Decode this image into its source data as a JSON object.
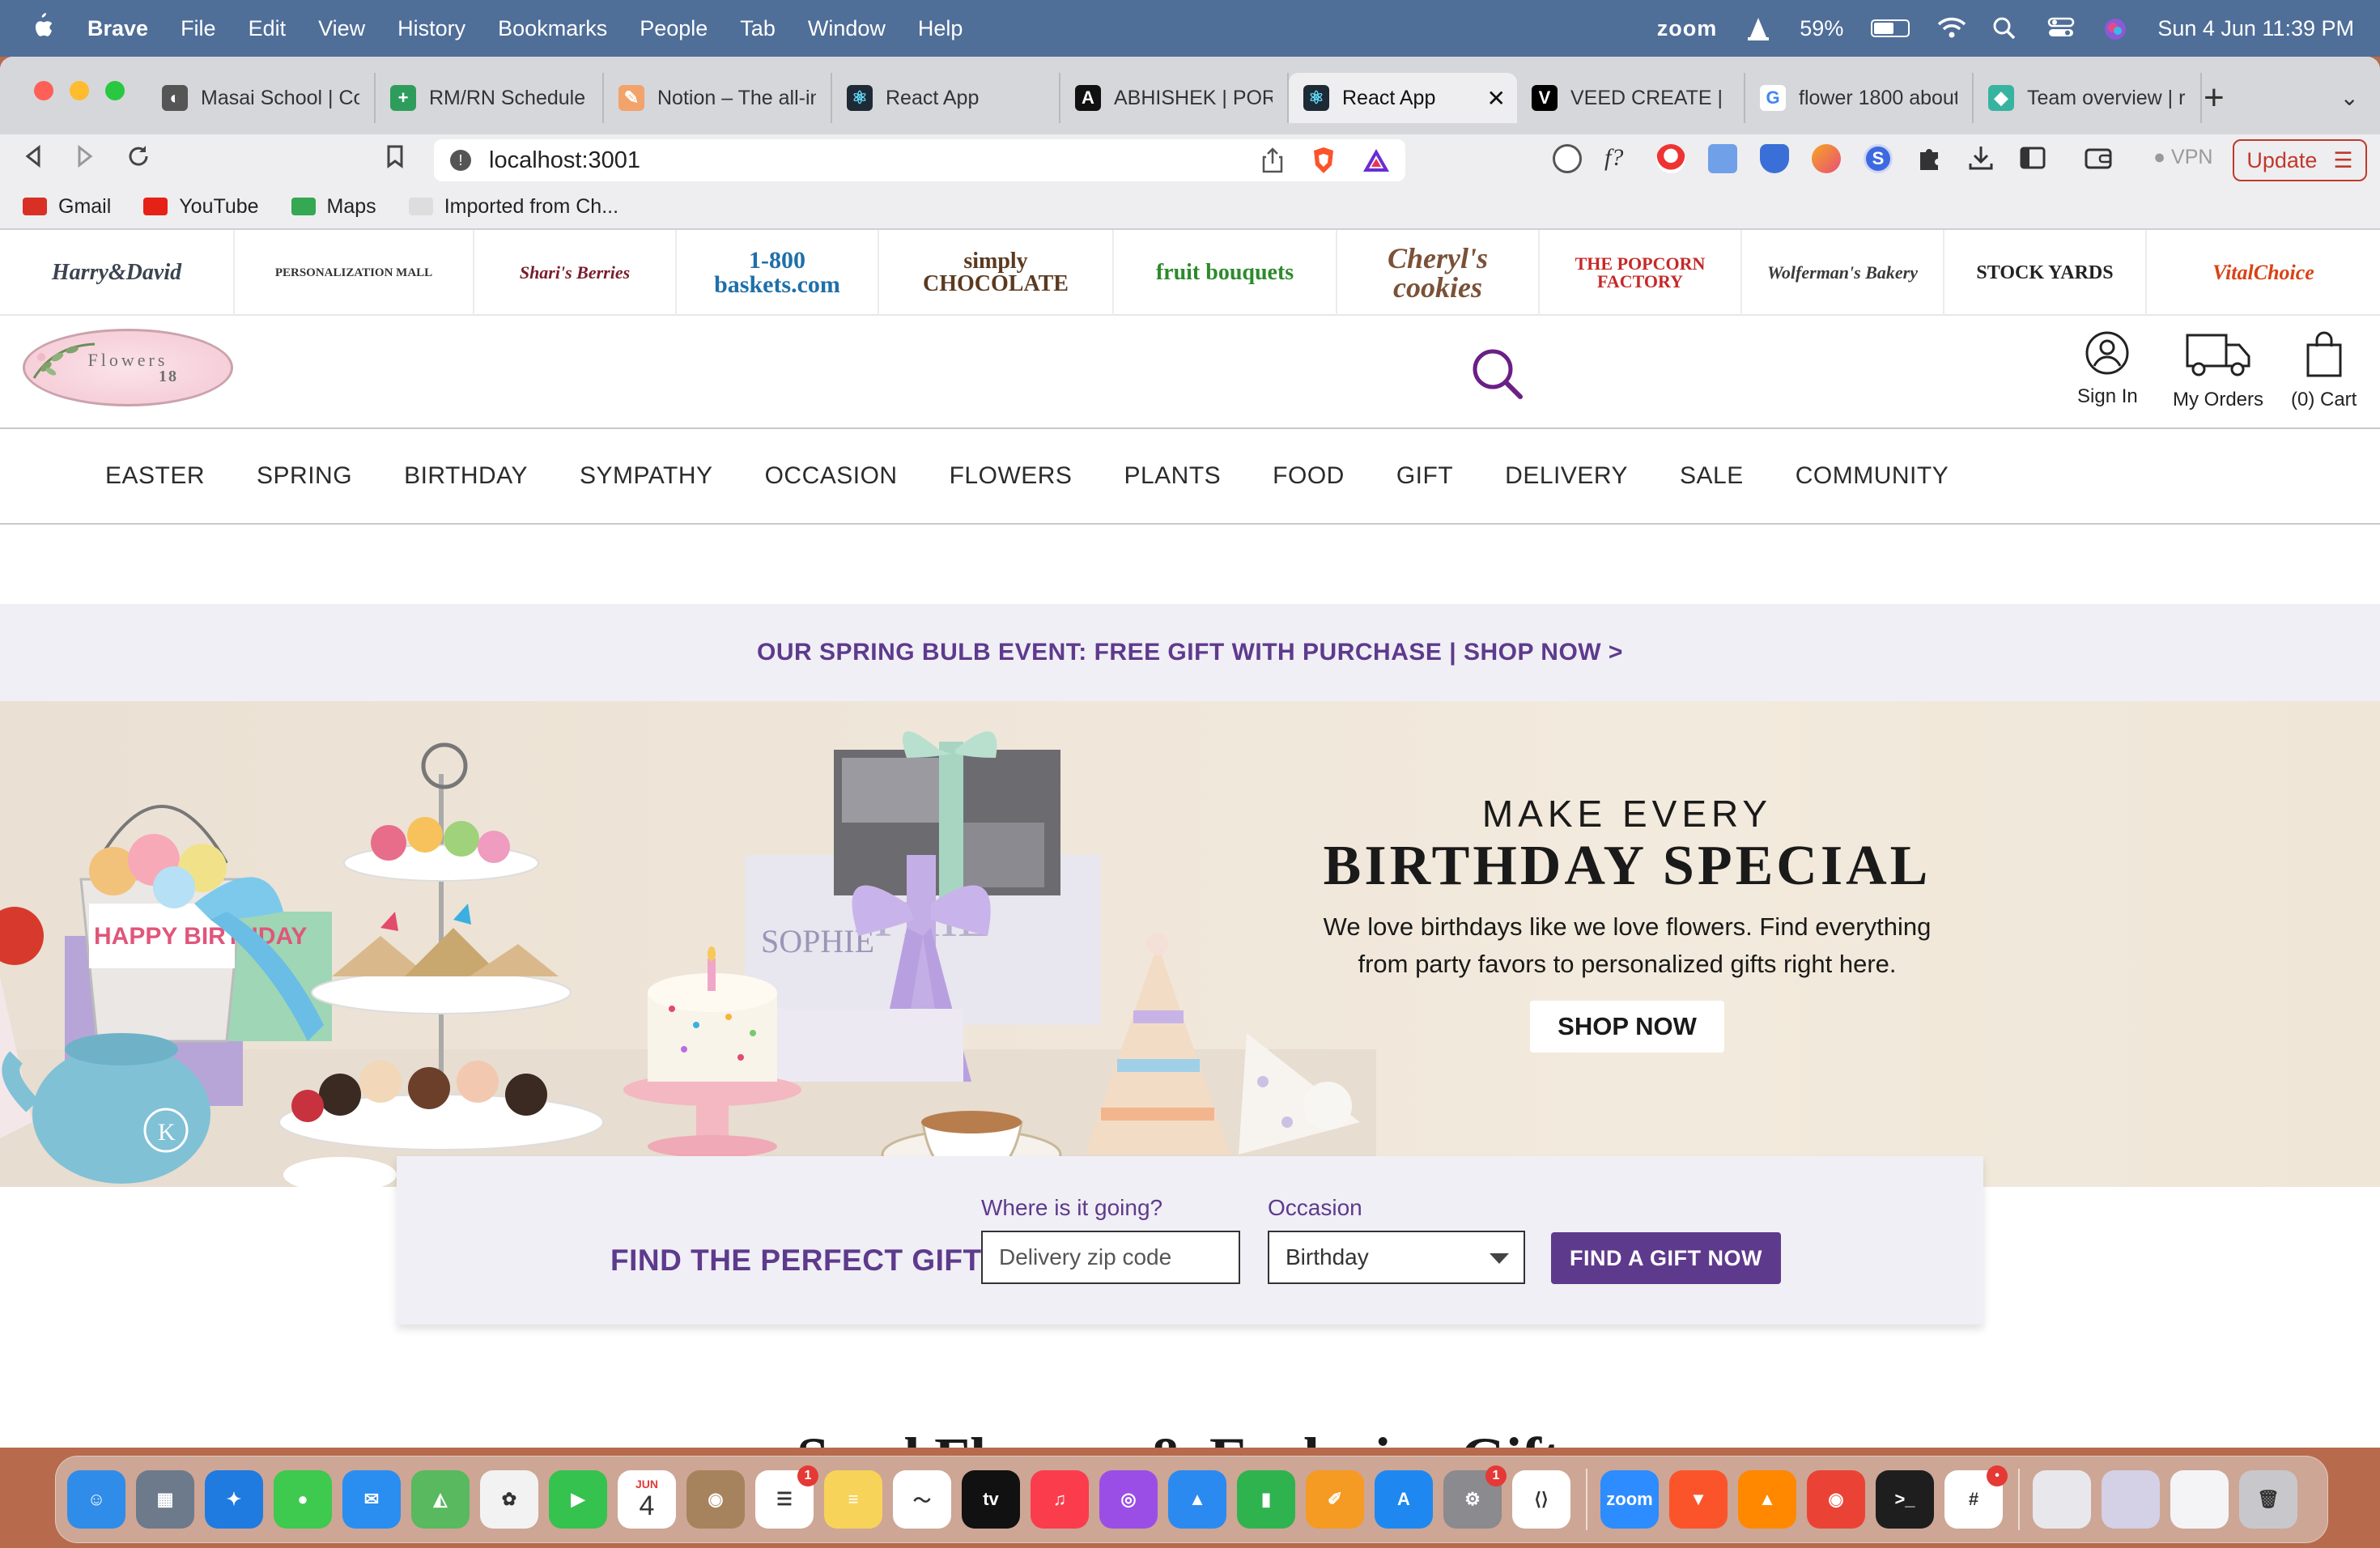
{
  "menubar": {
    "app": "Brave",
    "items": [
      "File",
      "Edit",
      "View",
      "History",
      "Bookmarks",
      "People",
      "Tab",
      "Window",
      "Help"
    ],
    "zoom": "zoom",
    "battery": "59%",
    "battery_level": 0.59,
    "datetime": "Sun 4 Jun  11:39 PM"
  },
  "tabs": [
    {
      "title": "Masai School | Co",
      "fav_color": "#555555",
      "fav": "◐"
    },
    {
      "title": "RM/RN Schedule N",
      "fav_color": "#2e9d5b",
      "fav": "+"
    },
    {
      "title": "Notion – The all-in",
      "fav_color": "#f2a36b",
      "fav": "✎"
    },
    {
      "title": "React App",
      "fav_color": "#1e2a36",
      "fav": "⚛"
    },
    {
      "title": "ABHISHEK | PORT",
      "fav_color": "#111111",
      "fav": "A"
    },
    {
      "title": "React App",
      "fav_color": "#1e2a36",
      "fav": "⚛",
      "active": true
    },
    {
      "title": "VEED CREATE | Ed",
      "fav_color": "#000000",
      "fav": "V"
    },
    {
      "title": "flower 1800 about",
      "fav_color": "#ffffff",
      "fav": "G"
    },
    {
      "title": "Team overview | ra",
      "fav_color": "#36b49f",
      "fav": "◆"
    }
  ],
  "toolbar": {
    "url": "localhost:3001",
    "vpn": "VPN",
    "update": "Update"
  },
  "bookmarks": [
    {
      "label": "Gmail",
      "color": "#d93025"
    },
    {
      "label": "YouTube",
      "color": "#e62117"
    },
    {
      "label": "Maps",
      "color": "#34a853"
    },
    {
      "label": "Imported from Ch...",
      "color": "#dddddd"
    }
  ],
  "brands": [
    {
      "name": "Harry&David",
      "color": "#3b4450",
      "size": 28,
      "style": "italic"
    },
    {
      "name": "PERSONALIZATION MALL",
      "color": "#333333",
      "size": 15,
      "style": "normal"
    },
    {
      "name": "Shari's Berries",
      "color": "#7a1c2c",
      "size": 22,
      "style": "italic"
    },
    {
      "name": "1-800 baskets.com",
      "color": "#1f6fa9",
      "size": 30,
      "style": "normal"
    },
    {
      "name": "simply CHOCOLATE",
      "color": "#5b3a20",
      "size": 28,
      "style": "normal"
    },
    {
      "name": "fruit bouquets",
      "color": "#2d8a2d",
      "size": 28,
      "style": "normal"
    },
    {
      "name": "Cheryl's cookies",
      "color": "#7a5138",
      "size": 36,
      "style": "italic"
    },
    {
      "name": "THE POPCORN FACTORY",
      "color": "#c62828",
      "size": 22,
      "style": "normal"
    },
    {
      "name": "Wolferman's Bakery",
      "color": "#3a3a3a",
      "size": 22,
      "style": "italic"
    },
    {
      "name": "STOCK YARDS",
      "color": "#222222",
      "size": 24,
      "style": "normal"
    },
    {
      "name": "VitalChoice",
      "color": "#d84315",
      "size": 26,
      "style": "italic"
    }
  ],
  "logo": {
    "line1": "Flowers",
    "line2": "18"
  },
  "header_actions": {
    "signin": "Sign In",
    "orders": "My Orders",
    "cart": "(0) Cart"
  },
  "nav": [
    "EASTER",
    "SPRING",
    "BIRTHDAY",
    "SYMPATHY",
    "OCCASION",
    "FLOWERS",
    "PLANTS",
    "FOOD",
    "GIFT",
    "DELIVERY",
    "SALE",
    "COMMUNITY"
  ],
  "promo": "OUR SPRING BULB EVENT: FREE GIFT WITH PURCHASE | SHOP NOW >",
  "hero": {
    "pre": "MAKE EVERY",
    "title": "BIRTHDAY SPECIAL",
    "desc1": "We love birthdays like we love flowers. Find everything",
    "desc2": "from party favors to personalized gifts right here.",
    "cta": "SHOP NOW",
    "bucket_text": "HAPPY BIRTHDAY",
    "gift_text": "SOPHIE",
    "teapot_initial": "K"
  },
  "finder": {
    "title": "FIND THE PERFECT GIFT",
    "zip_label": "Where is it going?",
    "zip_placeholder": "Delivery zip code",
    "occasion_label": "Occasion",
    "occasion_value": "Birthday",
    "button": "FIND A GIFT NOW"
  },
  "section_title": "Send Flowers & Exclusive Gifts",
  "dock": [
    {
      "name": "finder",
      "color": "#2f8ce9",
      "glyph": "☺"
    },
    {
      "name": "launchpad",
      "color": "#6c7a8c",
      "glyph": "▦"
    },
    {
      "name": "safari",
      "color": "#1f7be0",
      "glyph": "✦"
    },
    {
      "name": "messages",
      "color": "#3ec94f",
      "glyph": "●"
    },
    {
      "name": "mail",
      "color": "#2a8df0",
      "glyph": "✉"
    },
    {
      "name": "maps",
      "color": "#58b95f",
      "glyph": "◭"
    },
    {
      "name": "photos",
      "color": "#f2f2f2",
      "glyph": "✿"
    },
    {
      "name": "facetime",
      "color": "#35c24f",
      "glyph": "▶"
    },
    {
      "name": "calendar",
      "color": "#ffffff",
      "glyph": "4",
      "sub": "JUN"
    },
    {
      "name": "contacts",
      "color": "#a7835d",
      "glyph": "◉"
    },
    {
      "name": "reminders",
      "color": "#ffffff",
      "glyph": "☰",
      "badge": "1"
    },
    {
      "name": "notes",
      "color": "#f7d35a",
      "glyph": "≡"
    },
    {
      "name": "freeform",
      "color": "#ffffff",
      "glyph": "〜"
    },
    {
      "name": "apple-tv",
      "color": "#111111",
      "glyph": "tv"
    },
    {
      "name": "music",
      "color": "#fa3c4c",
      "glyph": "♫"
    },
    {
      "name": "podcasts",
      "color": "#9b4ee6",
      "glyph": "◎"
    },
    {
      "name": "keynote",
      "color": "#2b8af0",
      "glyph": "▲"
    },
    {
      "name": "numbers",
      "color": "#2fb34f",
      "glyph": "▮"
    },
    {
      "name": "pages",
      "color": "#f59a23",
      "glyph": "✐"
    },
    {
      "name": "app-store",
      "color": "#1e88f0",
      "glyph": "A"
    },
    {
      "name": "system-settings",
      "color": "#8a8a8f",
      "glyph": "⚙",
      "badge": "1"
    },
    {
      "name": "vscode",
      "color": "#ffffff",
      "glyph": "⟨⟩"
    },
    {
      "name": "zoom",
      "color": "#2d8cff",
      "glyph": "zoom",
      "sep_before": true
    },
    {
      "name": "brave",
      "color": "#fb542b",
      "glyph": "▼"
    },
    {
      "name": "vlc",
      "color": "#ff8800",
      "glyph": "▲"
    },
    {
      "name": "chrome",
      "color": "#ea4335",
      "glyph": "◉"
    },
    {
      "name": "terminal",
      "color": "#1e1e1e",
      "glyph": ">_"
    },
    {
      "name": "slack",
      "color": "#ffffff",
      "glyph": "#",
      "badge": "•"
    },
    {
      "name": "screenshot-1",
      "color": "#e8e8ec",
      "glyph": "",
      "sep_before": true
    },
    {
      "name": "screenshot-2",
      "color": "#d4d0e6",
      "glyph": ""
    },
    {
      "name": "screenshot-3",
      "color": "#f4f4f7",
      "glyph": ""
    },
    {
      "name": "trash",
      "color": "#c8c8cc",
      "glyph": "🗑"
    }
  ]
}
